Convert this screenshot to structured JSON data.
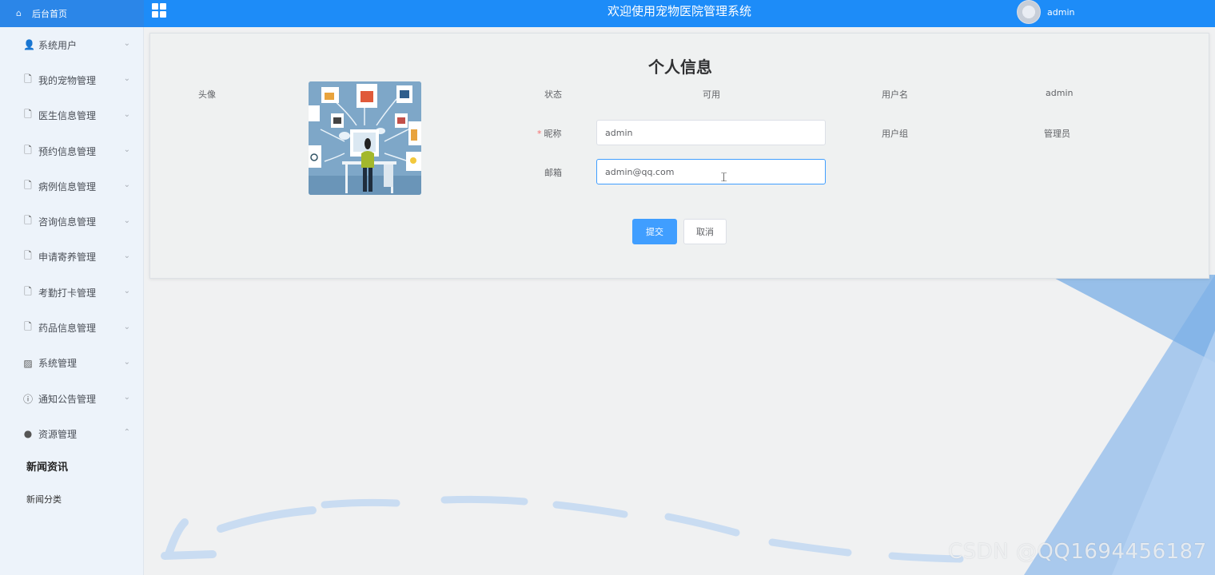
{
  "header": {
    "home_label": "后台首页",
    "title": "欢迎使用宠物医院管理系统",
    "username": "admin"
  },
  "sidebar": {
    "items": [
      {
        "label": "系统用户",
        "icon": "user-icon",
        "glyph": "👤",
        "chev": "⌄"
      },
      {
        "label": "我的宠物管理",
        "icon": "document-icon",
        "glyph": "🗋",
        "chev": "⌄"
      },
      {
        "label": "医生信息管理",
        "icon": "document-icon",
        "glyph": "🗋",
        "chev": "⌄"
      },
      {
        "label": "预约信息管理",
        "icon": "document-icon",
        "glyph": "🗋",
        "chev": "⌄"
      },
      {
        "label": "病例信息管理",
        "icon": "document-icon",
        "glyph": "🗋",
        "chev": "⌄"
      },
      {
        "label": "咨询信息管理",
        "icon": "document-icon",
        "glyph": "🗋",
        "chev": "⌄"
      },
      {
        "label": "申请寄养管理",
        "icon": "document-icon",
        "glyph": "🗋",
        "chev": "⌄"
      },
      {
        "label": "考勤打卡管理",
        "icon": "document-icon",
        "glyph": "🗋",
        "chev": "⌄"
      },
      {
        "label": "药品信息管理",
        "icon": "document-icon",
        "glyph": "🗋",
        "chev": "⌄"
      },
      {
        "label": "系统管理",
        "icon": "picture-icon",
        "glyph": "▨",
        "chev": "⌄"
      },
      {
        "label": "通知公告管理",
        "icon": "info-circle-icon",
        "glyph": "ⓘ",
        "chev": "⌄"
      },
      {
        "label": "资源管理",
        "icon": "location-pin-icon",
        "glyph": "●",
        "chev": "⌃"
      }
    ],
    "subitems": [
      {
        "label": "新闻资讯",
        "active": true
      },
      {
        "label": "新闻分类",
        "active": false
      }
    ]
  },
  "profile": {
    "title": "个人信息",
    "avatar_label": "头像",
    "status_label": "状态",
    "status_value": "可用",
    "username_label": "用户名",
    "username_value": "admin",
    "nickname_label": "昵称",
    "nickname_value": "admin",
    "usergroup_label": "用户组",
    "usergroup_value": "管理员",
    "email_label": "邮箱",
    "email_value": "admin@qq.com",
    "submit_label": "提交",
    "cancel_label": "取消"
  },
  "watermark": "CSDN @QQ1694456187",
  "colors": {
    "topbar": "#1d8cf8",
    "primary": "#409eff",
    "required": "#f56c6c"
  }
}
